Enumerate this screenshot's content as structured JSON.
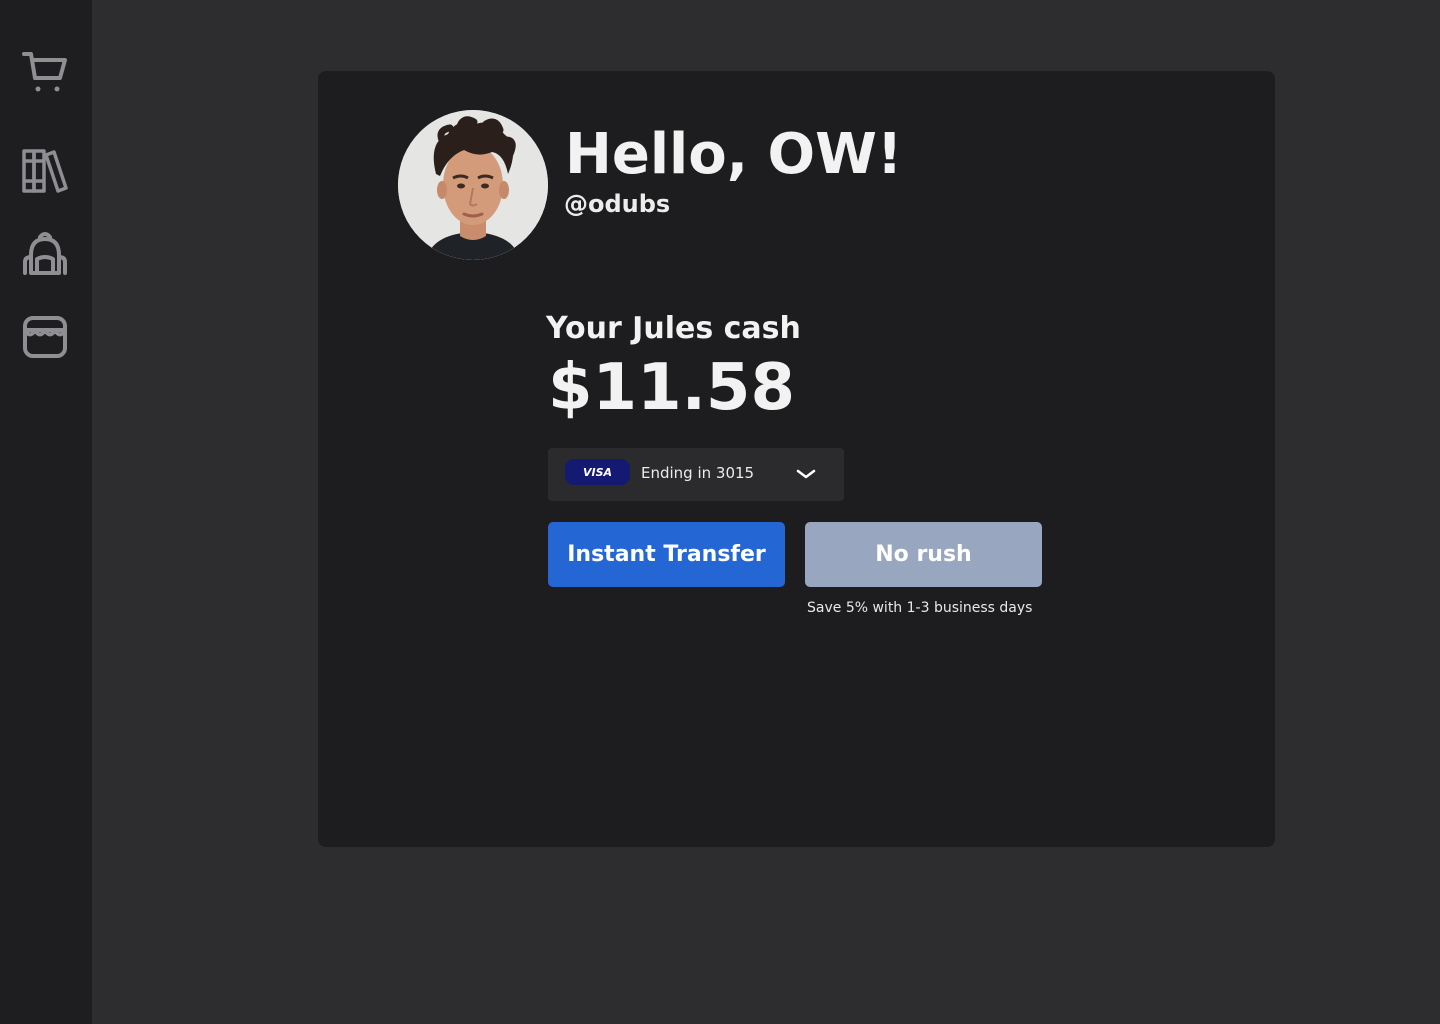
{
  "sidebar": {
    "items": [
      {
        "icon": "cart-icon"
      },
      {
        "icon": "library-icon"
      },
      {
        "icon": "backpack-icon"
      },
      {
        "icon": "store-icon"
      }
    ]
  },
  "profile": {
    "greeting": "Hello, OW!",
    "handle": "@odubs"
  },
  "balance": {
    "label": "Your Jules cash",
    "amount": "$11.58"
  },
  "payment_method": {
    "brand": "VISA",
    "ending": "Ending in 3015"
  },
  "actions": {
    "instant_label": "Instant Transfer",
    "norush_label": "No rush",
    "norush_note": "Save 5% with 1-3 business days"
  },
  "colors": {
    "accent": "#2467d4",
    "secondary": "#98a6bf",
    "visa_badge": "#141a72"
  }
}
